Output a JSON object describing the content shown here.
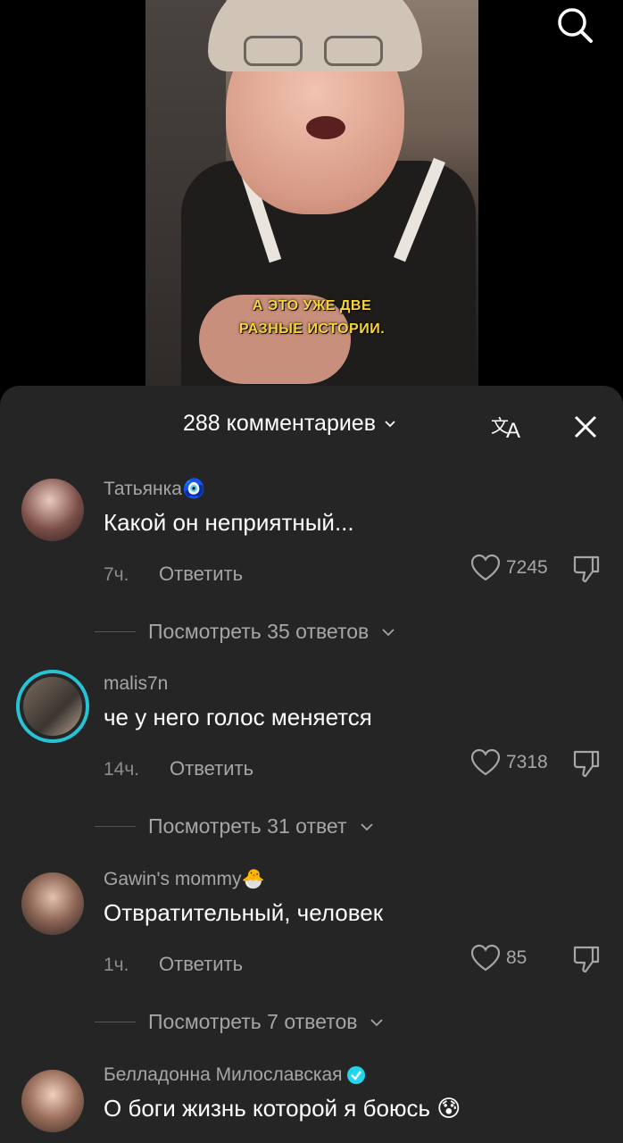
{
  "video": {
    "subtitle_line1": "А ЭТО УЖЕ ДВЕ",
    "subtitle_line2": "РАЗНЫЕ ИСТОРИИ."
  },
  "icons": {
    "search": "search-icon",
    "translate": "translate-icon",
    "close": "close-icon",
    "like": "heart-icon",
    "dislike": "thumbs-down-icon",
    "chevron": "chevron-down-icon"
  },
  "sheet": {
    "title": "288 комментариев"
  },
  "comments": [
    {
      "username": "Татьянка🧿",
      "text": "Какой он неприятный...",
      "time": "7ч.",
      "reply_label": "Ответить",
      "likes": "7245",
      "view_replies": "Посмотреть 35 ответов"
    },
    {
      "username": "malis7n",
      "text": "че у него голос меняется",
      "time": "14ч.",
      "reply_label": "Ответить",
      "likes": "7318",
      "view_replies": "Посмотреть 31 ответ"
    },
    {
      "username": "Gawin's mommy🐣",
      "text": "Отвратительный, человек",
      "time": "1ч.",
      "reply_label": "Ответить",
      "likes": "85",
      "view_replies": "Посмотреть 7 ответов"
    },
    {
      "username": "Белладонна Милославская",
      "text": "О боги жизнь которой я боюсь 😰",
      "verified": true
    }
  ],
  "colors": {
    "sheet_bg": "#252525",
    "story_ring": "#27c3d4",
    "verified": "#20d5ec",
    "subtitle": "#f7d43a"
  }
}
